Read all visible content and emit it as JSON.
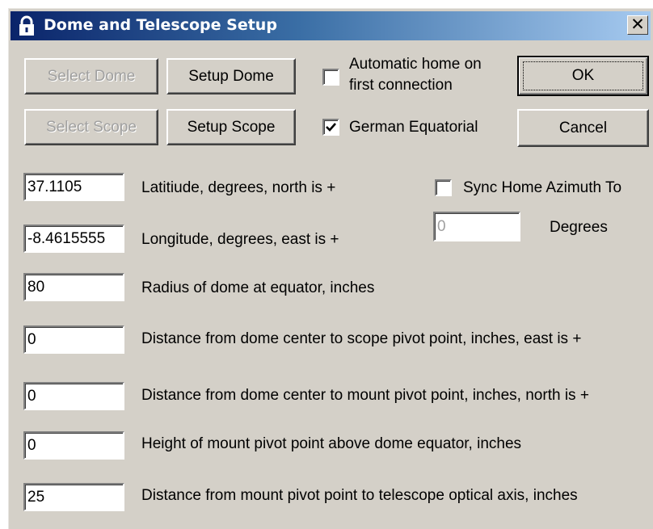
{
  "window": {
    "title": "Dome and Telescope Setup",
    "close_glyph": "✕"
  },
  "buttons": {
    "select_dome": "Select Dome",
    "setup_dome": "Setup Dome",
    "select_scope": "Select Scope",
    "setup_scope": "Setup Scope",
    "ok": "OK",
    "cancel": "Cancel"
  },
  "options": {
    "auto_home_line1": "Automatic home on",
    "auto_home_line2": "first connection",
    "auto_home_checked": false,
    "german_equatorial": "German Equatorial",
    "german_equatorial_checked": true,
    "sync_home_azimuth": "Sync Home Azimuth To",
    "sync_home_azimuth_checked": false,
    "sync_degrees_value": "0",
    "degrees_label": "Degrees"
  },
  "fields": [
    {
      "value": "37.1105",
      "label": "Latitiude, degrees, north is +"
    },
    {
      "value": "-8.4615555",
      "label": "Longitude, degrees, east is +"
    },
    {
      "value": "80",
      "label": "Radius of dome at equator, inches"
    },
    {
      "value": "0",
      "label": "Distance from dome center to scope pivot point, inches, east is +"
    },
    {
      "value": "0",
      "label": "Distance from dome center to mount pivot point, inches, north is +"
    },
    {
      "value": "0",
      "label": "Height of mount pivot point above dome equator, inches"
    },
    {
      "value": "25",
      "label": "Distance from mount pivot point to telescope optical axis, inches"
    }
  ],
  "icons": {
    "title_icon": "padlock-icon",
    "checkmark": "checkmark-icon"
  },
  "colors": {
    "title_start": "#0a246a",
    "title_end": "#a6caf0",
    "face": "#d4d0c8"
  }
}
